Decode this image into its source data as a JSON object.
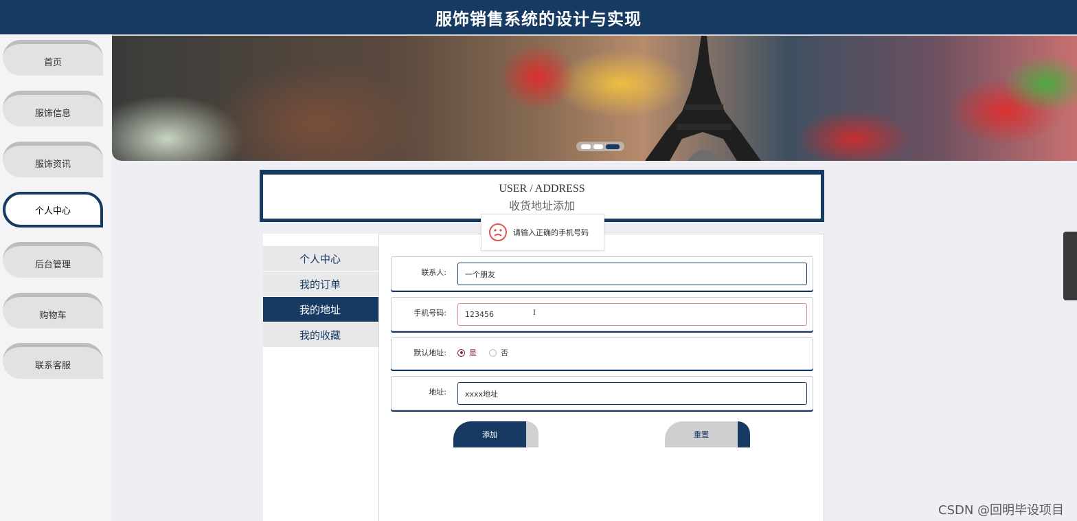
{
  "header": {
    "title": "服饰销售系统的设计与实现"
  },
  "nav": {
    "items": [
      {
        "label": "首页"
      },
      {
        "label": "服饰信息"
      },
      {
        "label": "服饰资讯"
      },
      {
        "label": "个人中心",
        "active": true
      },
      {
        "label": "后台管理"
      },
      {
        "label": "购物车"
      },
      {
        "label": "联系客服"
      }
    ]
  },
  "banner": {
    "slide_count": 3,
    "active_slide": 3
  },
  "section": {
    "title_en": "USER / ADDRESS",
    "title_cn": "收货地址添加"
  },
  "toast": {
    "message": "请输入正确的手机号码"
  },
  "sidemenu": {
    "items": [
      {
        "label": "个人中心"
      },
      {
        "label": "我的订单"
      },
      {
        "label": "我的地址",
        "active": true
      },
      {
        "label": "我的收藏"
      }
    ]
  },
  "form": {
    "contact_label": "联系人:",
    "contact_value": "一个朋友",
    "phone_label": "手机号码:",
    "phone_value": "123456",
    "default_label": "默认地址:",
    "default_yes": "是",
    "default_no": "否",
    "address_label": "地址:",
    "address_value": "xxxx地址",
    "add_button": "添加",
    "reset_button": "重置"
  },
  "watermark": "CSDN @回明毕设项目",
  "colors": {
    "primary": "#173a63",
    "error": "#e08b85",
    "radio": "#7a2b3a"
  }
}
